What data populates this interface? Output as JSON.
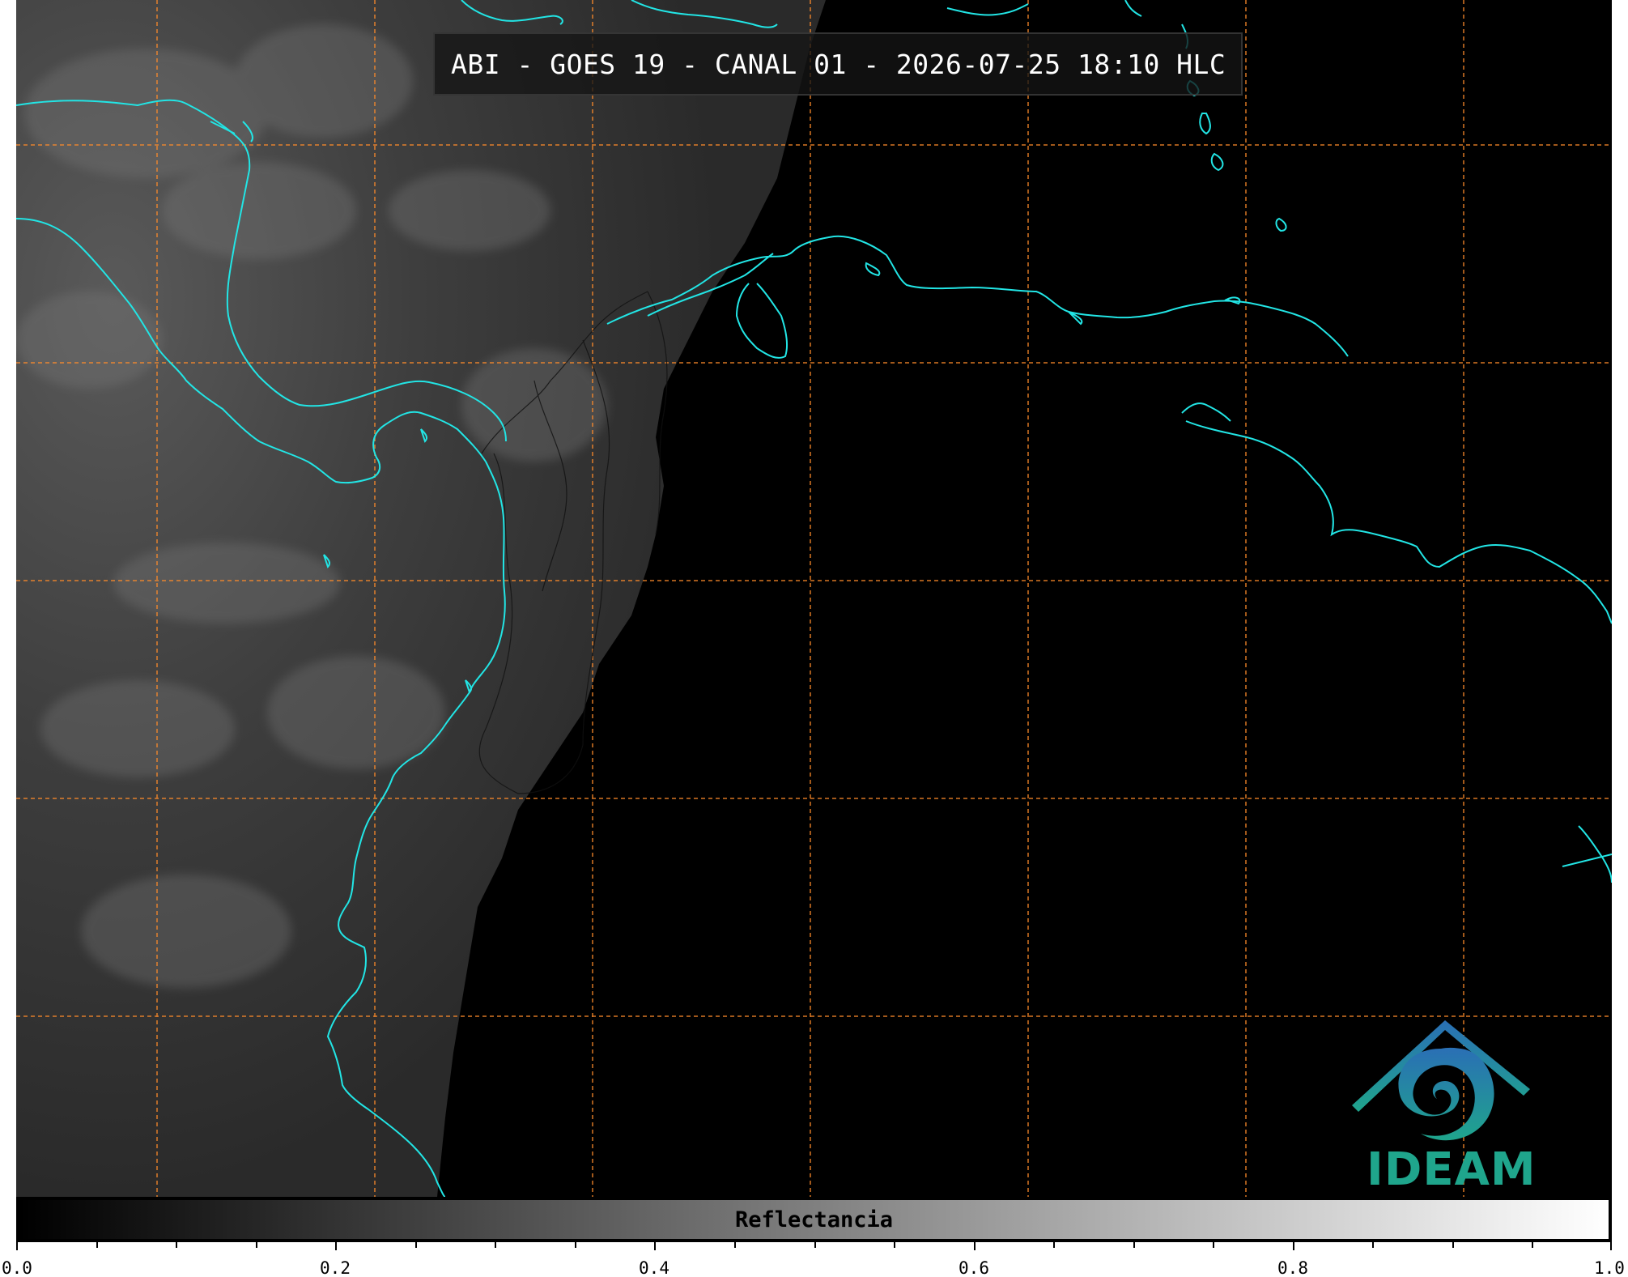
{
  "title": "ABI - GOES 19 - CANAL 01 - 2026-07-25 18:10 HLC",
  "logo": {
    "text": "IDEAM",
    "colors": {
      "blue": "#2a6fb5",
      "teal": "#1fa58c"
    }
  },
  "colorbar": {
    "label": "Reflectancia",
    "range": [
      0.0,
      1.0
    ],
    "colormap": "gray",
    "major_ticks": [
      "0.0",
      "0.2",
      "0.4",
      "0.6",
      "0.8",
      "1.0"
    ],
    "minor_tick_step": 0.05
  },
  "map": {
    "product": "Visible reflectance",
    "coastline_color": "#22e5e5",
    "gridline_color": "#ff8c2a",
    "border_color": "#000000",
    "gridlines_dashed": true
  }
}
